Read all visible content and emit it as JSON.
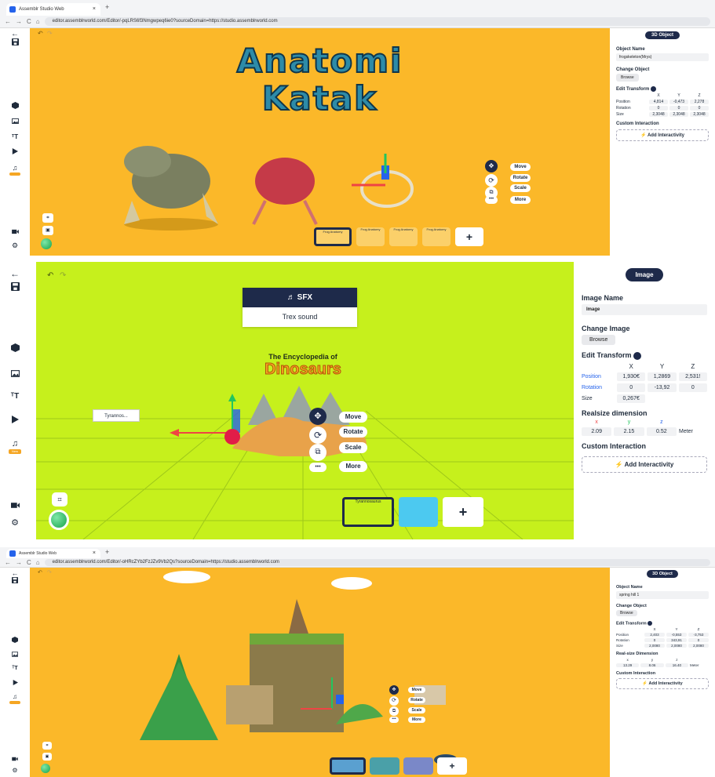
{
  "browser": {
    "tab_title": "Assemblr Studio Web",
    "tab_close": "×",
    "new_tab": "+",
    "back": "←",
    "forward": "→",
    "reload": "C",
    "home": "⌂",
    "url1": "editor.assemblrworld.com/Editor/-pqLRS6f3Nmgwpeq6ie0?sourceDomain=https://studio.assemblrworld.com",
    "url3": "editor.assemblrworld.com/Editor/-oHRcZYb2FzJZv9Vb2Qs?sourceDomain=https://studio.assemblrworld.com"
  },
  "panel1": {
    "title_line1": "Anatomi",
    "title_line2": "Katak",
    "object_badge": "3D Object",
    "object_name_label": "Object Name",
    "object_name": "frogskeleton(Mrys)",
    "change_object_label": "Change Object",
    "browse": "Browse",
    "edit_transform_label": "Edit Transform",
    "axes": [
      "X",
      "Y",
      "Z"
    ],
    "rows": [
      {
        "label": "Position",
        "values": [
          "4,814",
          "-0,473",
          "2,278"
        ]
      },
      {
        "label": "Rotation",
        "values": [
          "0",
          "0",
          "0"
        ]
      },
      {
        "label": "Size",
        "values": [
          "2,3048",
          "2,3048",
          "2,3048"
        ]
      }
    ],
    "custom_interaction_label": "Custom Interaction",
    "add_interactivity": "Add Interactivity",
    "gizmo": {
      "move": "Move",
      "rotate": "Rotate",
      "scale": "Scale",
      "more": "More"
    },
    "thumbs": [
      "Frog Anatomy",
      "Frog Anatomy",
      "Frog Anatomy",
      "Frog Anatomy"
    ],
    "add": "+"
  },
  "panel2": {
    "sfx_label": "SFX",
    "sound_name": "Trex sound",
    "book_title": "The Encyclopedia of",
    "book_subtitle": "Dinosaurs",
    "tag_label": "Tyrannos...",
    "object_badge": "Image",
    "image_name_label": "Image Name",
    "image_name": "Image",
    "change_image_label": "Change Image",
    "browse": "Browse",
    "edit_transform_label": "Edit Transform",
    "axes": [
      "X",
      "Y",
      "Z"
    ],
    "rows": [
      {
        "label": "Position",
        "values": [
          "1,930€",
          "1,2869",
          "2,531!"
        ]
      },
      {
        "label": "Rotation",
        "values": [
          "0",
          "-13,92",
          "0"
        ]
      },
      {
        "label": "Size",
        "values": [
          "0,267€",
          "",
          ""
        ]
      }
    ],
    "realsize_label": "Realsize dimension",
    "realsize_axes": [
      "x",
      "y",
      "z"
    ],
    "realsize_values": [
      "2.09",
      "2.15",
      "0.52"
    ],
    "realsize_unit": "Meter",
    "custom_interaction_label": "Custom Interaction",
    "add_interactivity": "Add Interactivity",
    "gizmo": {
      "move": "Move",
      "rotate": "Rotate",
      "scale": "Scale",
      "more": "More"
    },
    "thumbs": [
      "Tyrannosaurus",
      ""
    ],
    "add": "+",
    "music_badge": "New"
  },
  "panel3": {
    "object_badge": "3D Object",
    "object_name_label": "Object Name",
    "object_name": "spring hill 1",
    "change_object_label": "Change Object",
    "browse": "Browse",
    "edit_transform_label": "Edit Transform",
    "axes": [
      "X",
      "Y",
      "Z"
    ],
    "rows": [
      {
        "label": "Position",
        "values": [
          "2,403",
          "-0,553",
          "-3,753"
        ]
      },
      {
        "label": "Rotation",
        "values": [
          "0",
          "343,91",
          "0"
        ]
      },
      {
        "label": "Size",
        "values": [
          "2,0080",
          "2,0080",
          "2,0080"
        ]
      }
    ],
    "realsize_label": "Real-size Dimension",
    "realsize_axes": [
      "x",
      "y",
      "z"
    ],
    "realsize_values": [
      "13.29",
      "8.06",
      "16.40"
    ],
    "realsize_unit": "Meter",
    "custom_interaction_label": "Custom Interaction",
    "add_interactivity": "Add Interactivity",
    "gizmo": {
      "move": "Move",
      "rotate": "Rotate",
      "scale": "Scale",
      "more": "More"
    },
    "add": "+"
  },
  "colors": {
    "canvas_orange": "#fbb829",
    "canvas_lime": "#c6f01c",
    "navy": "#1e2a4a",
    "accent_orange": "#f5a623"
  },
  "icons": [
    "back-arrow-icon",
    "save-icon",
    "cube-icon",
    "image-icon",
    "text-icon",
    "play-icon",
    "music-icon",
    "video-icon",
    "gear-icon",
    "undo-icon",
    "redo-icon",
    "move-icon",
    "rotate-icon",
    "scale-icon",
    "more-icon",
    "lightning-icon",
    "ar-frame-icon"
  ]
}
